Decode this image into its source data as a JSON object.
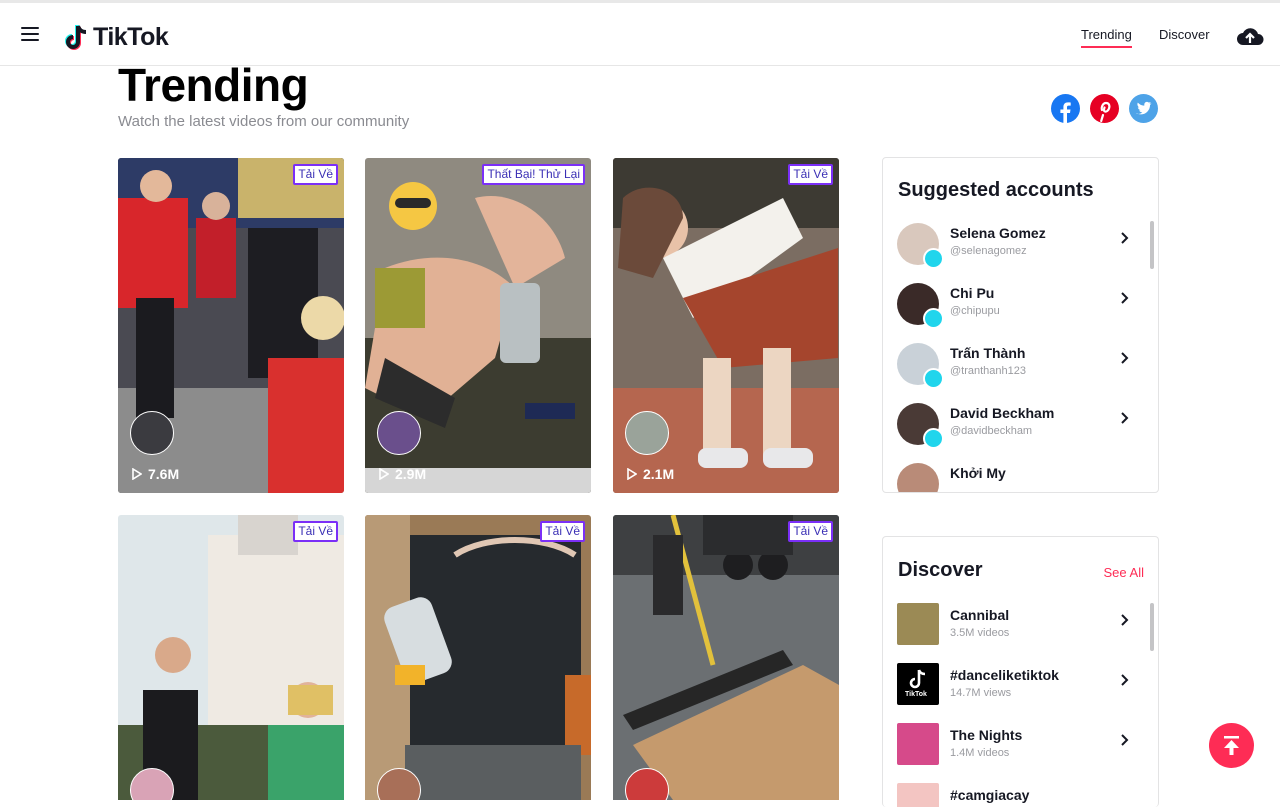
{
  "header": {
    "logo_text": "TikTok",
    "nav_trending": "Trending",
    "nav_discover": "Discover"
  },
  "page": {
    "title": "Trending",
    "subtitle": "Watch the latest videos from our community"
  },
  "videos": [
    {
      "badge": "Tải Về",
      "views": "7.6M"
    },
    {
      "badge": "Thất Bại! Thử Lại",
      "views": "2.9M"
    },
    {
      "badge": "Tải Về",
      "views": "2.1M"
    },
    {
      "badge": "Tải Về",
      "views": ""
    },
    {
      "badge": "Tải Về",
      "views": ""
    },
    {
      "badge": "Tải Về",
      "views": ""
    }
  ],
  "suggested": {
    "title": "Suggested accounts",
    "accounts": [
      {
        "name": "Selena Gomez",
        "handle": "@selenagomez"
      },
      {
        "name": "Chi Pu",
        "handle": "@chipupu"
      },
      {
        "name": "Trấn Thành",
        "handle": "@tranthanh123"
      },
      {
        "name": "David Beckham",
        "handle": "@davidbeckham"
      },
      {
        "name": "Khởi My",
        "handle": ""
      }
    ]
  },
  "discover": {
    "title": "Discover",
    "see_all": "See All",
    "items": [
      {
        "name": "Cannibal",
        "stat": "3.5M videos"
      },
      {
        "name": "#danceliketiktok",
        "stat": "14.7M views"
      },
      {
        "name": "The Nights",
        "stat": "1.4M videos"
      },
      {
        "name": "#camgiacay",
        "stat": ""
      }
    ],
    "tiktok_thumb_text": "TikTok"
  },
  "colors": {
    "accent": "#fe2c55",
    "badge_border": "#7b2ff7",
    "verified": "#20d5ec"
  }
}
